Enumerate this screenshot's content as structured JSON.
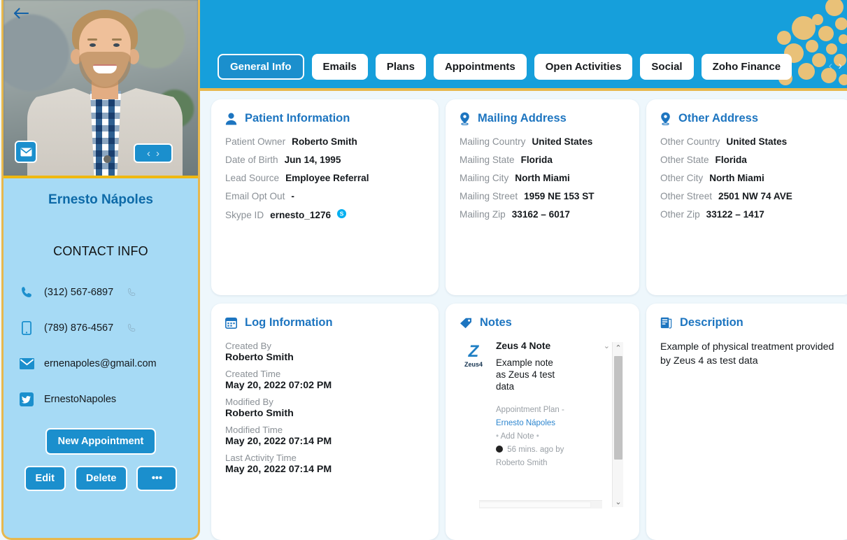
{
  "sidebar": {
    "back_icon": "back-arrow-icon",
    "mail_icon": "envelope-icon",
    "prev_label": "‹",
    "next_label": "›",
    "name": "Ernesto Nápoles",
    "contact_title": "CONTACT INFO",
    "contacts": [
      {
        "icon": "phone-icon",
        "value": "(312) 567-6897",
        "trailing": "call-icon"
      },
      {
        "icon": "mobile-icon",
        "value": "(789) 876-4567",
        "trailing": "call-icon"
      },
      {
        "icon": "email-icon",
        "value": "ernenapoles@gmail.com",
        "trailing": ""
      },
      {
        "icon": "twitter-icon",
        "value": "ErnestoNapoles",
        "trailing": ""
      }
    ],
    "new_appointment_label": "New Appointment",
    "edit_label": "Edit",
    "delete_label": "Delete",
    "more_label": "•••"
  },
  "header": {
    "accent_blue": "#169fdb",
    "accent_gold": "#e7b84e",
    "tabs": [
      {
        "label": "General Info",
        "active": true
      },
      {
        "label": "Emails",
        "active": false
      },
      {
        "label": "Plans",
        "active": false
      },
      {
        "label": "Appointments",
        "active": false
      },
      {
        "label": "Open Activities",
        "active": false
      },
      {
        "label": "Social",
        "active": false
      },
      {
        "label": "Zoho Finance",
        "active": false
      }
    ],
    "tab_prev": "‹",
    "tab_next": "›"
  },
  "cards": {
    "patient_information": {
      "title": "Patient Information",
      "icon": "person-icon",
      "fields": [
        {
          "label": "Patient Owner",
          "value": "Roberto Smith"
        },
        {
          "label": "Date of Birth",
          "value": "Jun 14, 1995"
        },
        {
          "label": "Lead Source",
          "value": "Employee Referral"
        },
        {
          "label": "Email Opt Out",
          "value": "-"
        },
        {
          "label": "Skype ID",
          "value": "ernesto_1276"
        }
      ],
      "skype_icon": "skype-icon"
    },
    "mailing_address": {
      "title": "Mailing Address",
      "icon": "location-pin-icon",
      "fields": [
        {
          "label": "Mailing Country",
          "value": "United States"
        },
        {
          "label": "Mailing State",
          "value": "Florida"
        },
        {
          "label": "Mailing City",
          "value": "North Miami"
        },
        {
          "label": "Mailing Street",
          "value": "1959 NE 153 ST"
        },
        {
          "label": "Mailing Zip",
          "value": "33162 – 6017"
        }
      ]
    },
    "other_address": {
      "title": "Other Address",
      "icon": "location-pin-icon",
      "fields": [
        {
          "label": "Other Country",
          "value": "United States"
        },
        {
          "label": "Other State",
          "value": "Florida"
        },
        {
          "label": "Other City",
          "value": "North Miami"
        },
        {
          "label": "Other Street",
          "value": "2501 NW 74 AVE"
        },
        {
          "label": "Other Zip",
          "value": "33122 – 1417"
        }
      ]
    },
    "log_information": {
      "title": "Log Information",
      "icon": "calendar-icon",
      "fields": [
        {
          "label": "Created By",
          "value": "Roberto Smith"
        },
        {
          "label": "Created Time",
          "value": "May 20, 2022 07:02 PM"
        },
        {
          "label": "Modified By",
          "value": "Roberto Smith"
        },
        {
          "label": "Modified Time",
          "value": "May 20, 2022 07:14 PM"
        },
        {
          "label": "Last Activity Time",
          "value": "May 20, 2022 07:14 PM"
        }
      ]
    },
    "notes": {
      "title": "Notes",
      "icon": "tag-icon",
      "note": {
        "logo_mark": "Z",
        "logo_label": "Zeus4",
        "title": "Zeus 4 Note",
        "body": "Example note as Zeus 4 test data",
        "plan_label": "Appointment Plan",
        "plan_value": "-",
        "contact_link": "Ernesto Nápoles",
        "add_note_label": "Add Note",
        "timestamp": "56 mins. ago",
        "by_label": "by",
        "author": "Roberto Smith"
      },
      "scroll_up": "⌃",
      "scroll_down": "⌄",
      "collapse": "⌄"
    },
    "description": {
      "title": "Description",
      "icon": "document-icon",
      "text": "Example of physical treatment provided by Zeus 4 as test data"
    }
  }
}
